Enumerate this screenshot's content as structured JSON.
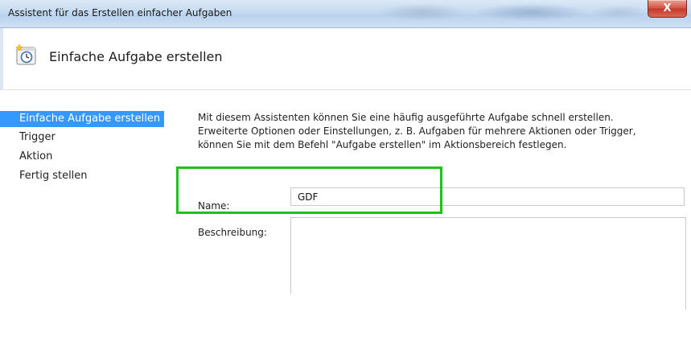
{
  "window": {
    "title": "Assistent für das Erstellen einfacher Aufgaben",
    "close_label": "X"
  },
  "header": {
    "title": "Einfache Aufgabe erstellen",
    "icon": "scheduled-task-clock-icon"
  },
  "sidebar": {
    "items": [
      {
        "label": "Einfache Aufgabe erstellen",
        "selected": true
      },
      {
        "label": "Trigger",
        "selected": false
      },
      {
        "label": "Aktion",
        "selected": false
      },
      {
        "label": "Fertig stellen",
        "selected": false
      }
    ]
  },
  "main": {
    "intro_lines": [
      "Mit diesem Assistenten können Sie eine häufig ausgeführte Aufgabe schnell erstellen.",
      "Erweiterte Optionen oder Einstellungen, z. B. Aufgaben für mehrere Aktionen oder Trigger,",
      "können Sie mit dem Befehl \"Aufgabe erstellen\" im Aktionsbereich festlegen."
    ],
    "name_label": "Name:",
    "name_value": "GDF",
    "description_label": "Beschreibung:",
    "description_value": ""
  },
  "colors": {
    "selection": "#3399ff",
    "highlight_box": "#22c11a",
    "close_button": "#c43a2b"
  }
}
